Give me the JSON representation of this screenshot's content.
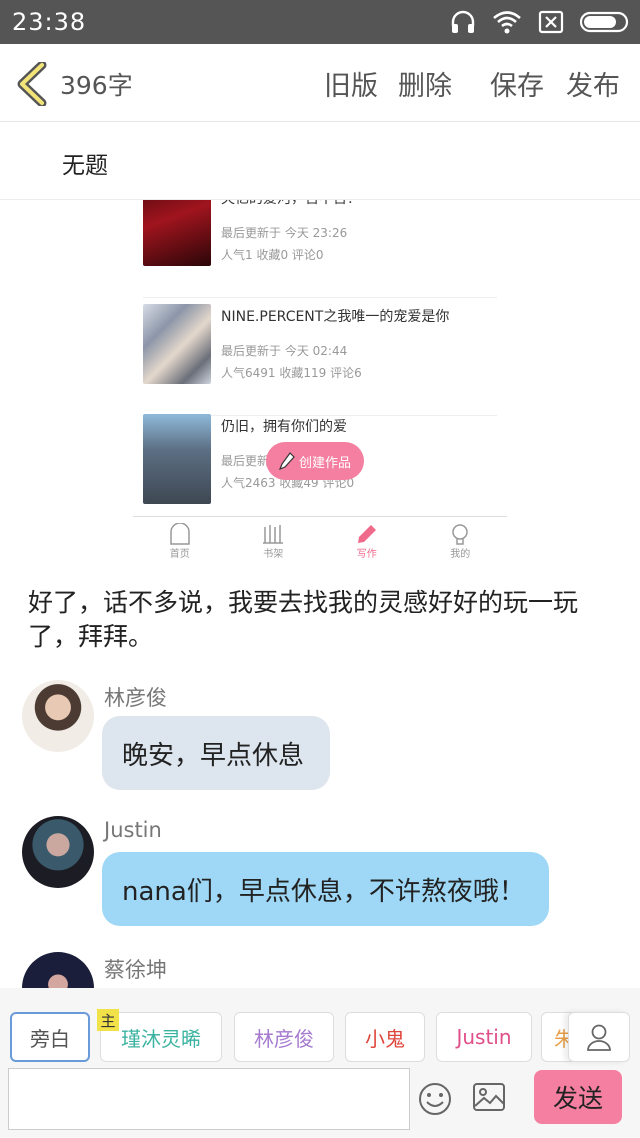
{
  "status": {
    "time": "23:38"
  },
  "header": {
    "word_count": "396字",
    "old_version": "旧版",
    "delete": "删除",
    "save": "保存",
    "publish": "发布"
  },
  "title": "无题",
  "embedded": {
    "items": [
      {
        "title": "失忆的爱河，苦不苦？",
        "updated": "最后更新于 今天 23:26",
        "stats": "人气1  收藏0  评论0"
      },
      {
        "title": "NINE.PERCENT之我唯一的宠爱是你",
        "updated": "最后更新于 今天 02:44",
        "stats": "人气6491  收藏119  评论6"
      },
      {
        "title": "仍旧，拥有你们的爱",
        "updated": "最后更新",
        "stats": "人气2463  收藏49  评论0"
      }
    ],
    "create_button": "创建作品",
    "tabs": [
      {
        "label": "首页"
      },
      {
        "label": "书架"
      },
      {
        "label": "写作"
      },
      {
        "label": "我的"
      }
    ]
  },
  "body_text": "好了，话不多说，我要去找我的灵感好好的玩一玩了，拜拜。",
  "messages": [
    {
      "name": "林彦俊",
      "text": "晚安，早点休息"
    },
    {
      "name": "Justin",
      "text": "nana们，早点休息，不许熬夜哦！"
    },
    {
      "name": "蔡徐坤",
      "text": ""
    }
  ],
  "roles": [
    {
      "label": "旁白",
      "color": "#555555"
    },
    {
      "label": "瑾沐灵晞",
      "color": "#3bb3a0",
      "badge": "主"
    },
    {
      "label": "林彦俊",
      "color": "#a67bd0"
    },
    {
      "label": "小鬼",
      "color": "#e0463c"
    },
    {
      "label": "Justin",
      "color": "#e04f8a"
    },
    {
      "label": "朱",
      "color": "#e8a04a"
    }
  ],
  "input": {
    "value": "",
    "placeholder": ""
  },
  "send_label": "发送"
}
